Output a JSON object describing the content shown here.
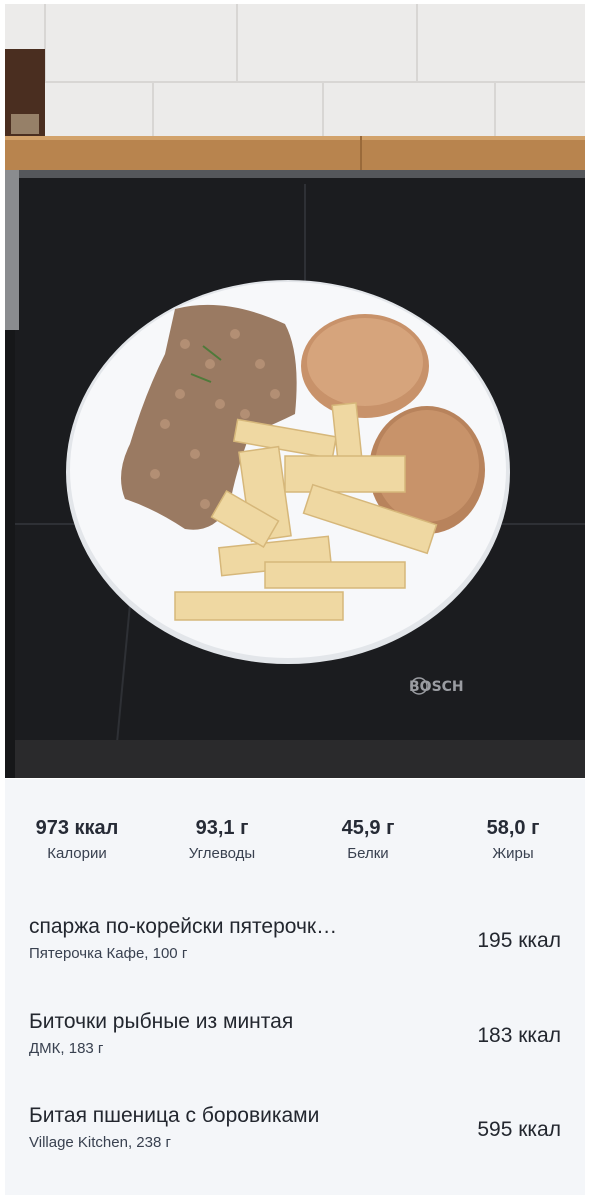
{
  "photo": {
    "stove_brand": "BOSCH"
  },
  "summary": {
    "calories": {
      "value": "973 ккал",
      "label": "Калории"
    },
    "carbs": {
      "value": "93,1 г",
      "label": "Углеводы"
    },
    "protein": {
      "value": "45,9 г",
      "label": "Белки"
    },
    "fat": {
      "value": "58,0 г",
      "label": "Жиры"
    }
  },
  "items": [
    {
      "name": "спаржа по-корейски пятерочк…",
      "detail": "Пятерочка Кафе, 100 г",
      "kcal": "195 ккал"
    },
    {
      "name": "Биточки рыбные из минтая",
      "detail": "ДМК, 183 г",
      "kcal": "183 ккал"
    },
    {
      "name": "Битая пшеница с боровиками",
      "detail": "Village Kitchen, 238 г",
      "kcal": "595 ккал"
    }
  ]
}
